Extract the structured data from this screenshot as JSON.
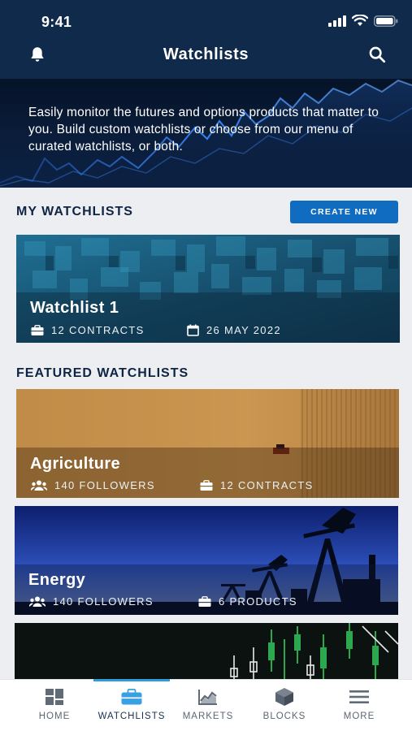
{
  "status_bar": {
    "time": "9:41"
  },
  "header": {
    "title": "Watchlists",
    "left_icon": "bell-icon",
    "right_icon": "search-icon"
  },
  "hero": {
    "text": "Easily monitor the futures and options products that matter to you. Build custom watchlists or choose from our menu of curated watchlists, or both."
  },
  "my_watchlists": {
    "title": "MY WATCHLISTS",
    "create_label": "CREATE NEW",
    "items": [
      {
        "name": "Watchlist 1",
        "contracts": "12 CONTRACTS",
        "date": "26 MAY 2022"
      }
    ]
  },
  "featured": {
    "title": "FEATURED WATCHLISTS",
    "items": [
      {
        "name": "Agriculture",
        "followers": "140 FOLLOWERS",
        "count": "12 CONTRACTS"
      },
      {
        "name": "Energy",
        "followers": "140 FOLLOWERS",
        "count": "6 PRODUCTS"
      }
    ]
  },
  "tabs": [
    {
      "label": "HOME",
      "icon": "home-grid-icon",
      "active": false
    },
    {
      "label": "WATCHLISTS",
      "icon": "briefcase-icon",
      "active": true
    },
    {
      "label": "MARKETS",
      "icon": "chart-icon",
      "active": false
    },
    {
      "label": "BLOCKS",
      "icon": "cube-icon",
      "active": false
    },
    {
      "label": "MORE",
      "icon": "menu-icon",
      "active": false
    }
  ],
  "colors": {
    "header_bg": "#102a4c",
    "accent": "#0f6cc1",
    "tab_active_indicator": "#2f9be0",
    "page_bg": "#eceef1"
  }
}
